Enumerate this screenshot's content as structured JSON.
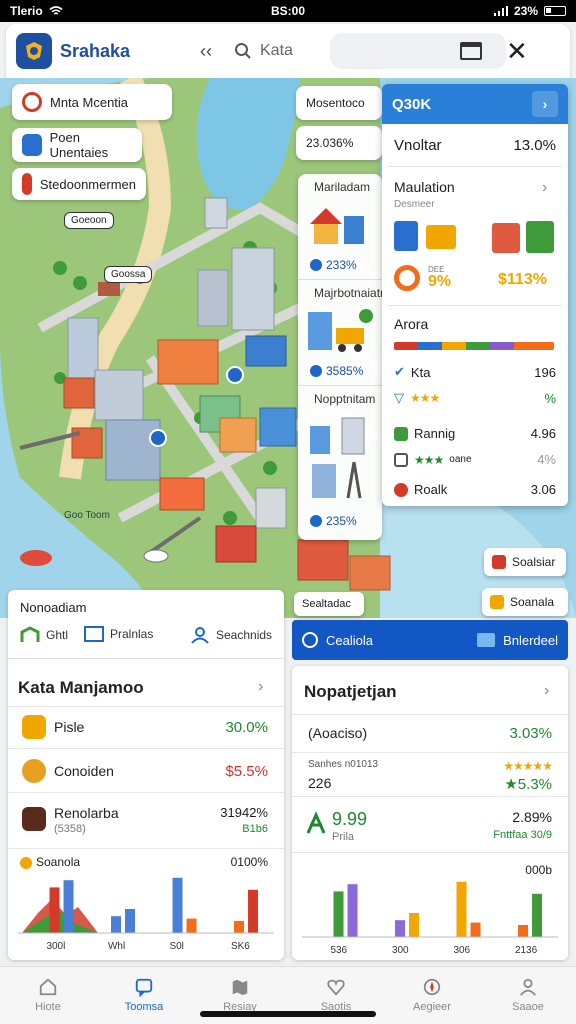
{
  "status": {
    "left": "Tlerio",
    "time": "BS:00",
    "battery": "23%"
  },
  "appbar": {
    "title": "Srahaka",
    "search_text": "Kata",
    "search_dropdown": "·"
  },
  "map_overlay": {
    "chips": [
      {
        "label": "Mnta Mcentia",
        "icon": "leaf-icon",
        "color": "#d23b2a"
      },
      {
        "label": "Poen Unentaies",
        "icon": "document-icon",
        "color": "#2a6fd0"
      },
      {
        "label": "Stedoonmermen",
        "icon": "image-icon",
        "color": "#d23b2a"
      }
    ],
    "pin_labels": [
      "Goeoon",
      "Goossa"
    ],
    "water_label": "Goo Toom",
    "top_cards": [
      {
        "label": "Mosentoco"
      },
      {
        "label": "23.036%"
      }
    ]
  },
  "mid_card": {
    "sections": [
      {
        "title": "Mariladam",
        "value": "233%"
      },
      {
        "title": "Majrbotnaiatn",
        "value": "3585%"
      },
      {
        "title": "Nopptnitam",
        "value": "235%"
      }
    ]
  },
  "right_card": {
    "header": "Q30K",
    "row1": {
      "label": "Vnoltar",
      "value": "13.0%"
    },
    "section2": {
      "title": "Maulation",
      "subtitle": "Desmeer",
      "pct_a": "9%",
      "pct_a_sub": "DEE",
      "pct_b": "$113%"
    },
    "section3": {
      "title": "Arora"
    },
    "list": [
      {
        "label": "Kta",
        "value": "196",
        "icon": "check-icon"
      },
      {
        "label": "",
        "value": "%",
        "icon": "shield-icon"
      },
      {
        "label": "Rannig",
        "value": "4.96",
        "icon": "ticket-icon"
      },
      {
        "label": "oane",
        "value": "4%",
        "icon": "book-icon"
      },
      {
        "label": "Roalk",
        "value": "3.06",
        "icon": "pin-icon"
      }
    ]
  },
  "float_badges": [
    {
      "label": "Soalsiar",
      "color": "#d23b2a"
    },
    {
      "label": "Soanala",
      "color": "#f2a600"
    },
    {
      "label": "Sealtadac"
    }
  ],
  "left_panel": {
    "heading": "Nonoadiam",
    "tabs": [
      "Ghtl",
      "Pralnlas",
      "Seachnids"
    ],
    "title": "Kata Manjamoo",
    "rows": [
      {
        "name": "Pisle",
        "value": "30.0%",
        "tone": "green",
        "icon_color": "#f2a600"
      },
      {
        "name": "Conoiden",
        "value": "$5.5%",
        "tone": "red",
        "icon_color": "#e8a020"
      },
      {
        "name": "Renolarba",
        "sub": "(5358)",
        "value": "31942%",
        "sub_value": "B1b6",
        "tone": "dark",
        "icon_color": "#5a2a1a"
      }
    ],
    "chart_title": "Soanola",
    "chart_value": "0100%",
    "axis": [
      "300l",
      "Whl",
      "S0l",
      "SK6"
    ]
  },
  "right_panel": {
    "bar_label": "Cealiola",
    "bar_right": "Bnlerdeel",
    "title": "Nopatjetjan",
    "rows": [
      {
        "name": "(Aoaciso)",
        "value": "3.03%"
      },
      {
        "name": "Sanhes n01013",
        "sub": "226",
        "value": "★5.3%"
      },
      {
        "name": "9.99",
        "sub": "Prila",
        "value": "2.89%",
        "sub_value": "Fnttfaa 30/9"
      }
    ],
    "stars_label": "★★★★★",
    "chart_value": "000b",
    "axis": [
      "536",
      "300",
      "306",
      "2136"
    ]
  },
  "chart_data": {
    "type": "bar",
    "title": "Soanola",
    "categories": [
      "300l",
      "Whl",
      "S0l",
      "SK6"
    ],
    "series": [
      {
        "values": [
          38,
          14,
          46,
          10
        ]
      },
      {
        "values": [
          44,
          20,
          12,
          36
        ]
      }
    ]
  },
  "bottomnav": [
    {
      "label": "Hiote",
      "icon": "home-icon",
      "active": false
    },
    {
      "label": "Toomsa",
      "icon": "chat-icon",
      "active": true
    },
    {
      "label": "Resiay",
      "icon": "map-icon",
      "active": false
    },
    {
      "label": "Saotis",
      "icon": "heart-icon",
      "active": false
    },
    {
      "label": "Aegieer",
      "icon": "compass-icon",
      "active": false
    },
    {
      "label": "Saaoe",
      "icon": "profile-icon",
      "active": false
    }
  ]
}
